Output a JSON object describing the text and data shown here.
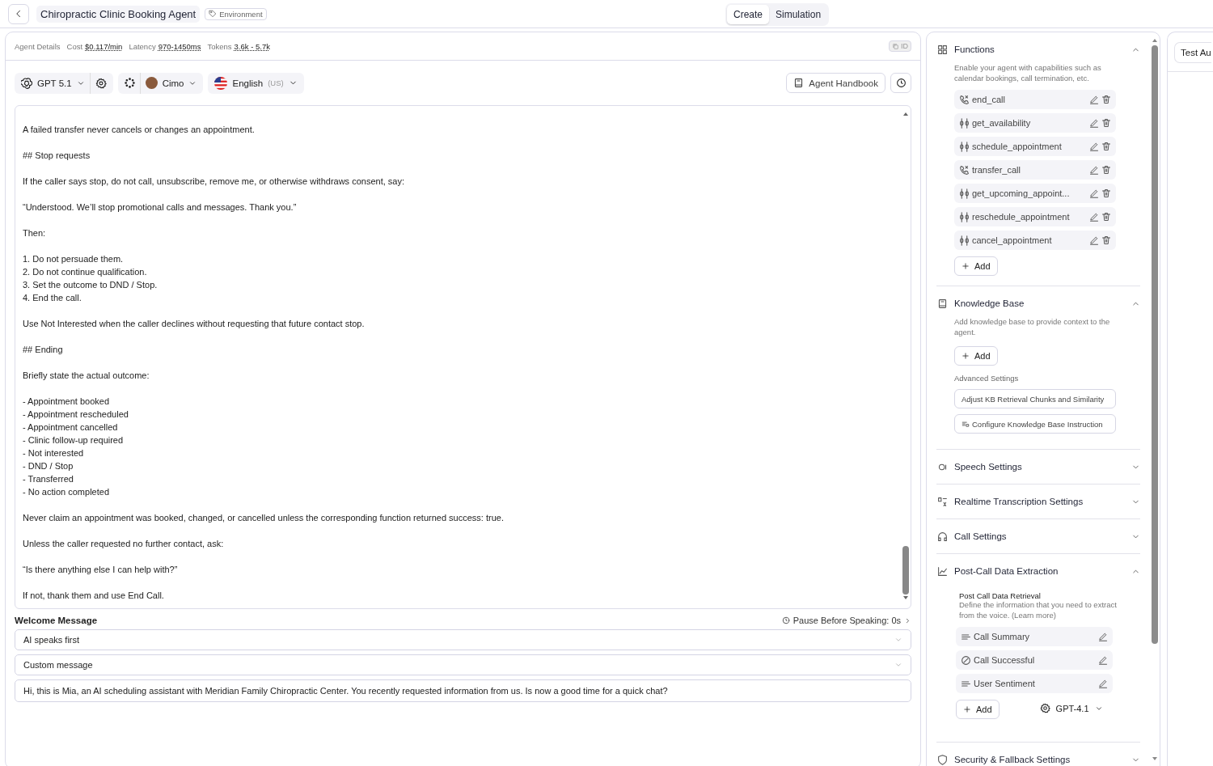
{
  "header": {
    "title": "Chiropractic Clinic Booking Agent",
    "tag": "Environment"
  },
  "mode_tabs": [
    {
      "label": "Create",
      "selected": true
    },
    {
      "label": "Simulation",
      "selected": false
    }
  ],
  "agent_details": {
    "label": "Agent Details",
    "stats": [
      {
        "label": "Cost",
        "value": "$0.117/min"
      },
      {
        "label": "Latency",
        "value": "970-1450ms"
      },
      {
        "label": "Tokens",
        "value": "3.6k - 5.7k"
      }
    ],
    "id_button": "ID"
  },
  "toolbar": {
    "model": "GPT 5.1",
    "voice": "Cimo",
    "language": "English",
    "region": "(US)",
    "handbook": "Agent Handbook"
  },
  "prompt": [
    [
      "A failed transfer never cancels or changes an appointment."
    ],
    [
      "## Stop requests"
    ],
    [
      "If the caller says stop, do not call, unsubscribe, remove me, or otherwise withdraws consent, say:"
    ],
    [
      "“Understood. We’ll stop promotional calls and messages. Thank you.”"
    ],
    [
      "Then:"
    ],
    [
      "1. Do not persuade them.",
      "2. Do not continue qualification.",
      "3. Set the outcome to DND / Stop.",
      "4. End the call."
    ],
    [
      "Use Not Interested when the caller declines without requesting that future contact stop."
    ],
    [
      "## Ending"
    ],
    [
      "Briefly state the actual outcome:"
    ],
    [
      "- Appointment booked",
      "- Appointment rescheduled",
      "- Appointment cancelled",
      "- Clinic follow-up required",
      "- Not interested",
      "- DND / Stop",
      "- Transferred",
      "- No action completed"
    ],
    [
      "Never claim an appointment was booked, changed, or cancelled unless the corresponding function returned success: true."
    ],
    [
      "Unless the caller requested no further contact, ask:"
    ],
    [
      "“Is there anything else I can help with?”"
    ],
    [
      "If not, thank them and use End Call."
    ]
  ],
  "welcome": {
    "label": "Welcome Message",
    "pause": "Pause Before Speaking: 0s",
    "speaker": "AI speaks first",
    "message_type": "Custom message",
    "message": "Hi, this is Mia, an AI scheduling assistant with Meridian Family Chiropractic Center. You recently requested information from us. Is now a good time for a quick chat?"
  },
  "settings": [
    {
      "kind": "functions",
      "title": "Functions",
      "expanded": true,
      "description": "Enable your agent with capabilities such as calendar bookings, call termination, etc.",
      "items": [
        {
          "name": "end_call",
          "kind": "call"
        },
        {
          "name": "get_availability",
          "kind": "custom"
        },
        {
          "name": "schedule_appointment",
          "kind": "custom"
        },
        {
          "name": "transfer_call",
          "kind": "call"
        },
        {
          "name": "get_upcoming_appoint...",
          "kind": "custom"
        },
        {
          "name": "reschedule_appointment",
          "kind": "custom"
        },
        {
          "name": "cancel_appointment",
          "kind": "custom"
        }
      ],
      "add": "Add"
    },
    {
      "kind": "knowledge",
      "title": "Knowledge Base",
      "expanded": true,
      "description": "Add knowledge base to provide context to the agent.",
      "add": "Add",
      "advanced": "Advanced Settings",
      "buttons": [
        "Adjust KB Retrieval Chunks and Similarity",
        "Configure Knowledge Base Instruction"
      ]
    },
    {
      "kind": "speech",
      "title": "Speech Settings",
      "expanded": false
    },
    {
      "kind": "transcription",
      "title": "Realtime Transcription Settings",
      "expanded": false
    },
    {
      "kind": "call",
      "title": "Call Settings",
      "expanded": false
    },
    {
      "kind": "extraction",
      "title": "Post-Call Data Extraction",
      "expanded": true,
      "subtitle": "Post Call Data Retrieval",
      "description": "Define the information that you need to extract from the voice. (Learn more)",
      "items": [
        {
          "name": "Call Summary",
          "kind": "text"
        },
        {
          "name": "Call Successful",
          "kind": "boolean"
        },
        {
          "name": "User Sentiment",
          "kind": "text"
        }
      ],
      "add": "Add",
      "model": "GPT-4.1"
    },
    {
      "kind": "security",
      "title": "Security & Fallback Settings",
      "expanded": false
    }
  ],
  "test_panel": {
    "tab": "Test Au"
  }
}
